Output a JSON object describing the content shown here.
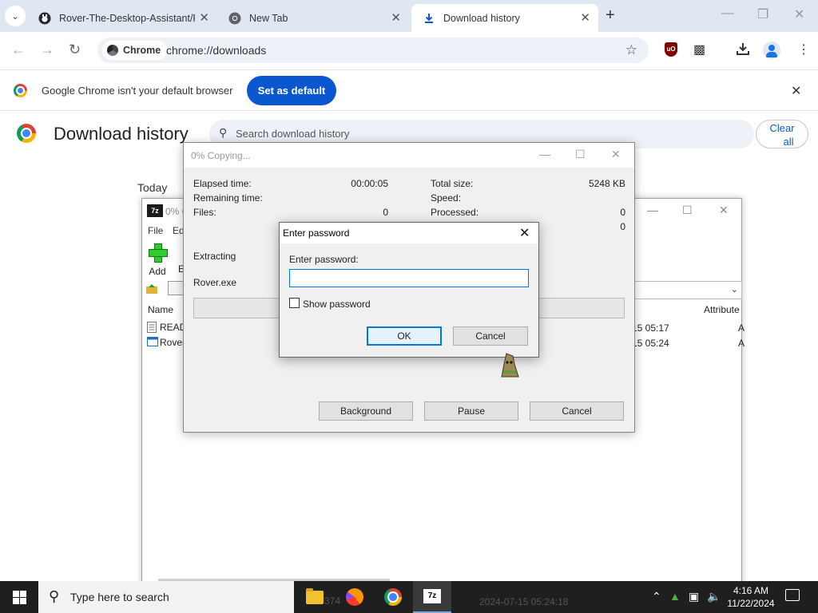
{
  "browser": {
    "tabs": [
      {
        "title": "Rover-The-Desktop-Assistant/R",
        "icon": "github-icon"
      },
      {
        "title": "New Tab",
        "icon": "chrome-icon"
      },
      {
        "title": "Download history",
        "icon": "download-icon"
      }
    ],
    "address": {
      "chip": "Chrome",
      "url": "chrome://downloads"
    }
  },
  "infobar": {
    "message": "Google Chrome isn't your default browser",
    "button": "Set as default"
  },
  "downloads_page": {
    "title": "Download history",
    "search_placeholder": "Search download history",
    "clear_all_1": "Clear",
    "clear_all_2": "all",
    "section": "Today"
  },
  "file_manager": {
    "title": "0% C",
    "menu": [
      "File",
      "Ed"
    ],
    "toolbar_add": "Add",
    "toolbar_e": "E",
    "columns": {
      "name": "Name",
      "attributes": "Attribute"
    },
    "rows": [
      {
        "name": "READ",
        "date": "15 05:17",
        "attr": "A"
      },
      {
        "name": "Rover",
        "date": "15 05:24",
        "attr": "A"
      }
    ],
    "bottom_text": "2024-07-15 05:24:18",
    "bottom_size": "374"
  },
  "copy_dialog": {
    "title": "0% Copying...",
    "elapsed_label": "Elapsed time:",
    "elapsed_value": "00:00:05",
    "remaining_label": "Remaining time:",
    "files_label": "Files:",
    "files_value": "0",
    "total_size_label": "Total size:",
    "total_size_value": "5248 KB",
    "speed_label": "Speed:",
    "processed_label": "Processed:",
    "processed_value": "0",
    "extra_value": "0",
    "operation": "Extracting",
    "current_file": "Rover.exe",
    "progress": 0,
    "buttons": {
      "background": "Background",
      "pause": "Pause",
      "cancel": "Cancel"
    }
  },
  "password_dialog": {
    "title": "Enter password",
    "label": "Enter password:",
    "value": "",
    "show_password_label": "Show password",
    "show_password_checked": false,
    "ok": "OK",
    "cancel": "Cancel"
  },
  "taskbar": {
    "search_placeholder": "Type here to search",
    "time": "4:16 AM",
    "date": "11/22/2024"
  },
  "colors": {
    "accent": "#0b57d0",
    "tabstrip": "#dfe7f3",
    "focus": "#0078d7"
  }
}
